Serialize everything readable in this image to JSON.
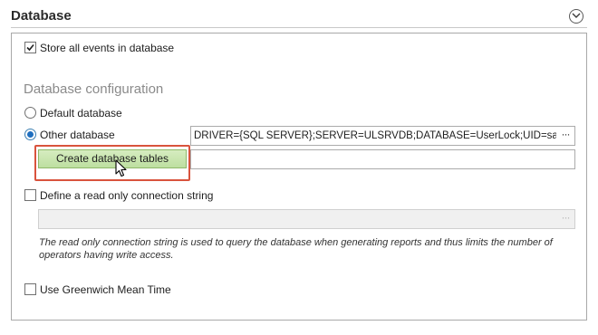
{
  "section": {
    "title": "Database"
  },
  "store_events": {
    "label": "Store all events in database",
    "checked": true
  },
  "config": {
    "heading": "Database configuration",
    "default_db_label": "Default database",
    "other_db_label": "Other database",
    "selected": "other",
    "connection_string": "DRIVER={SQL SERVER};SERVER=ULSRVDB;DATABASE=UserLock;UID=sa;",
    "create_tables_label": "Create database tables",
    "status_value": ""
  },
  "readonly": {
    "label": "Define a read only connection string",
    "checked": false,
    "value": "",
    "note": "The read only connection string is used to query the database when generating reports and thus limits the number of operators having write access."
  },
  "gmt": {
    "label": "Use Greenwich Mean Time",
    "checked": false
  },
  "ellipsis_glyph": "···",
  "icons": {
    "collapse": "chevron-down-circle-icon",
    "cursor": "mouse-pointer-icon"
  },
  "colors": {
    "button_bg": "#c6e5aa",
    "highlight": "#d9533d",
    "radio_selected": "#1f6fbf"
  }
}
